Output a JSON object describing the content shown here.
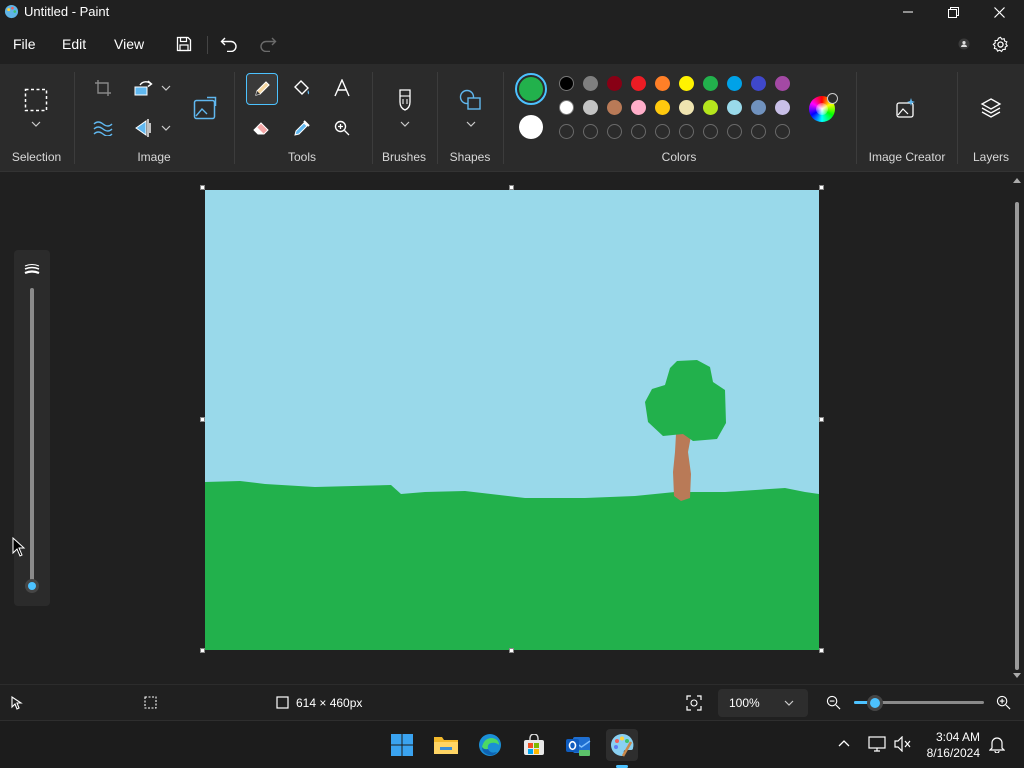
{
  "window": {
    "title": "Untitled - Paint"
  },
  "menu": {
    "file": "File",
    "edit": "Edit",
    "view": "View"
  },
  "ribbon": {
    "groups": {
      "selection": "Selection",
      "image": "Image",
      "tools": "Tools",
      "brushes": "Brushes",
      "shapes": "Shapes",
      "colors": "Colors",
      "image_creator": "Image Creator",
      "layers": "Layers"
    },
    "primary_color": "#22b14c",
    "secondary_color": "#ffffff",
    "palette_row1": [
      "#000000",
      "#7f7f7f",
      "#880015",
      "#ed1c24",
      "#ff7f27",
      "#fff200",
      "#22b14c",
      "#00a2e8",
      "#3f48cc",
      "#a349a4"
    ],
    "palette_row2": [
      "#ffffff",
      "#c3c3c3",
      "#b97a57",
      "#ffaec9",
      "#ffc90e",
      "#efe4b0",
      "#b5e61d",
      "#99d9ea",
      "#7092be",
      "#c8bfe7"
    ]
  },
  "status": {
    "canvas_size": "614 × 460px",
    "zoom": "100%"
  },
  "taskbar": {
    "time": "3:04 AM",
    "date": "8/16/2024"
  },
  "colors": {
    "sky": "#99d9ea",
    "grass": "#22b14c",
    "trunk": "#b97a57",
    "accent": "#4cc2ff"
  }
}
